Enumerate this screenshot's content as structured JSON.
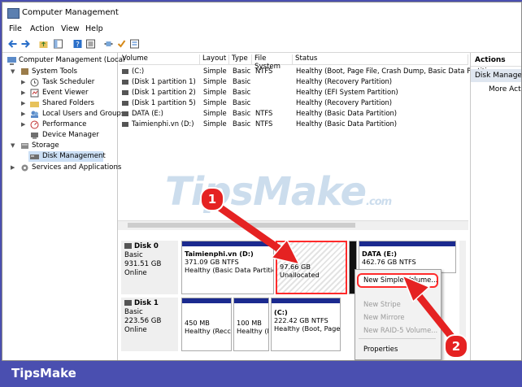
{
  "window": {
    "title": "Computer Management"
  },
  "menu": [
    "File",
    "Action",
    "View",
    "Help"
  ],
  "tree": {
    "root": "Computer Management (Local",
    "system_tools": "System Tools",
    "items": [
      "Task Scheduler",
      "Event Viewer",
      "Shared Folders",
      "Local Users and Groups",
      "Performance",
      "Device Manager"
    ],
    "storage": "Storage",
    "disk_management": "Disk Management",
    "services": "Services and Applications"
  },
  "table": {
    "headers": [
      "Volume",
      "Layout",
      "Type",
      "File System",
      "Status"
    ],
    "rows": [
      [
        "(C:)",
        "Simple",
        "Basic",
        "NTFS",
        "Healthy (Boot, Page File, Crash Dump, Basic Data Partition"
      ],
      [
        "(Disk 1 partition 1)",
        "Simple",
        "Basic",
        "",
        "Healthy (Recovery Partition)"
      ],
      [
        "(Disk 1 partition 2)",
        "Simple",
        "Basic",
        "",
        "Healthy (EFI System Partition)"
      ],
      [
        "(Disk 1 partition 5)",
        "Simple",
        "Basic",
        "",
        "Healthy (Recovery Partition)"
      ],
      [
        "DATA (E:)",
        "Simple",
        "Basic",
        "NTFS",
        "Healthy (Basic Data Partition)"
      ],
      [
        "Taimienphi.vn (D:)",
        "Simple",
        "Basic",
        "NTFS",
        "Healthy (Basic Data Partition)"
      ]
    ]
  },
  "disks": {
    "disk0": {
      "name": "Disk 0",
      "type": "Basic",
      "size": "931.51 GB",
      "state": "Online",
      "p1": {
        "title": "Taimienphi.vn  (D:)",
        "size": "371.09 GB NTFS",
        "status": "Healthy (Basic Data Partition"
      },
      "p2": {
        "size": "97.66 GB",
        "status": "Unallocated"
      },
      "p3": {
        "title": "DATA  (E:)",
        "size": "462.76 GB NTFS"
      }
    },
    "disk1": {
      "name": "Disk 1",
      "type": "Basic",
      "size": "223.56 GB",
      "state": "Online",
      "p1": {
        "size": "450 MB",
        "status": "Healthy (Recc"
      },
      "p2": {
        "size": "100 MB",
        "status": "Healthy (I"
      },
      "p3": {
        "title": "(C:)",
        "size": "222.42 GB NTFS",
        "status": "Healthy (Boot, Page F"
      }
    }
  },
  "actions": {
    "title": "Actions",
    "disk_management": "Disk Manager",
    "more": "More Act"
  },
  "context_menu": {
    "new_simple": "New Simple Volume...",
    "new_striped": "New Stripe",
    "new_mirrored": "New Mirrore",
    "new_raid5": "New RAID-5 Volume...",
    "properties": "Properties"
  },
  "watermark": {
    "text": "TipsMake",
    "suffix": ".com"
  },
  "badges": {
    "one": "1",
    "two": "2"
  },
  "footer": {
    "brand": "TipsMake"
  },
  "colors": {
    "partition_header": "#1b2a8f",
    "highlight": "#ff2b2b",
    "footer_bg": "#4a4fb0"
  }
}
